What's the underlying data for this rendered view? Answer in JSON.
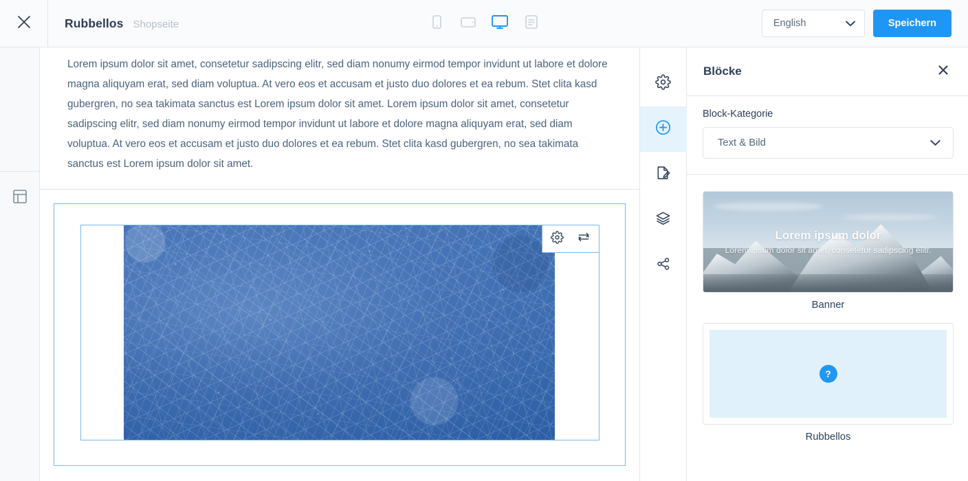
{
  "topbar": {
    "close_icon": "close-icon",
    "title": "Rubbellos",
    "subtitle": "Shopseite",
    "devices": [
      {
        "name": "mobile",
        "icon": "mobile-icon",
        "active": false
      },
      {
        "name": "tablet",
        "icon": "tablet-icon",
        "active": false
      },
      {
        "name": "desktop",
        "icon": "desktop-icon",
        "active": true
      },
      {
        "name": "list",
        "icon": "document-list-icon",
        "active": false
      }
    ],
    "language": "English",
    "language_chevron": "⌄",
    "save_label": "Speichern"
  },
  "left_gutter": {
    "layout_icon": "layout-template-icon"
  },
  "canvas": {
    "paragraph": "Lorem ipsum dolor sit amet, consetetur sadipscing elitr, sed diam nonumy eirmod tempor invidunt ut labore et dolore magna aliquyam erat, sed diam voluptua. At vero eos et accusam et justo duo dolores et ea rebum. Stet clita kasd gubergren, no sea takimata sanctus est Lorem ipsum dolor sit amet. Lorem ipsum dolor sit amet, consetetur sadipscing elitr, sed diam nonumy eirmod tempor invidunt ut labore et dolore magna aliquyam erat, sed diam voluptua. At vero eos et accusam et justo duo dolores et ea rebum. Stet clita kasd gubergren, no sea takimata sanctus est Lorem ipsum dolor sit amet.",
    "image_alt": "frozen-ice-texture",
    "toolbar": {
      "settings_icon": "gear-icon",
      "replace_icon": "swap-replace-icon"
    },
    "selection_color": "#7cb6f0"
  },
  "icon_rail": [
    {
      "name": "settings",
      "icon": "gear-icon",
      "active": false
    },
    {
      "name": "add-block",
      "icon": "plus-circle-icon",
      "active": true
    },
    {
      "name": "edit-page",
      "icon": "edit-document-icon",
      "active": false
    },
    {
      "name": "layers",
      "icon": "layers-icon",
      "active": false
    },
    {
      "name": "share",
      "icon": "share-icon",
      "active": false
    }
  ],
  "panel": {
    "title": "Blöcke",
    "close_icon": "close-icon",
    "category_label": "Block-Kategorie",
    "category_value": "Text & Bild",
    "category_chevron": "⌄",
    "blocks": [
      {
        "name": "Banner",
        "thumb_type": "banner-image",
        "overlay_heading": "Lorem ipsum dolor",
        "overlay_text": "Lorem ipsum dolor sit amet, consetetur sadipscing elitr."
      },
      {
        "name": "Rubbellos",
        "thumb_type": "placeholder",
        "badge": "?"
      }
    ]
  },
  "colors": {
    "accent": "#1e96f5",
    "save_button": "#1e96f5",
    "text_dark": "#2c4057",
    "text_muted": "#b7c0cb",
    "border": "#e3e7eb",
    "rail_active_bg": "#e5f3fd",
    "placeholder_bg": "#e1f1fb"
  }
}
